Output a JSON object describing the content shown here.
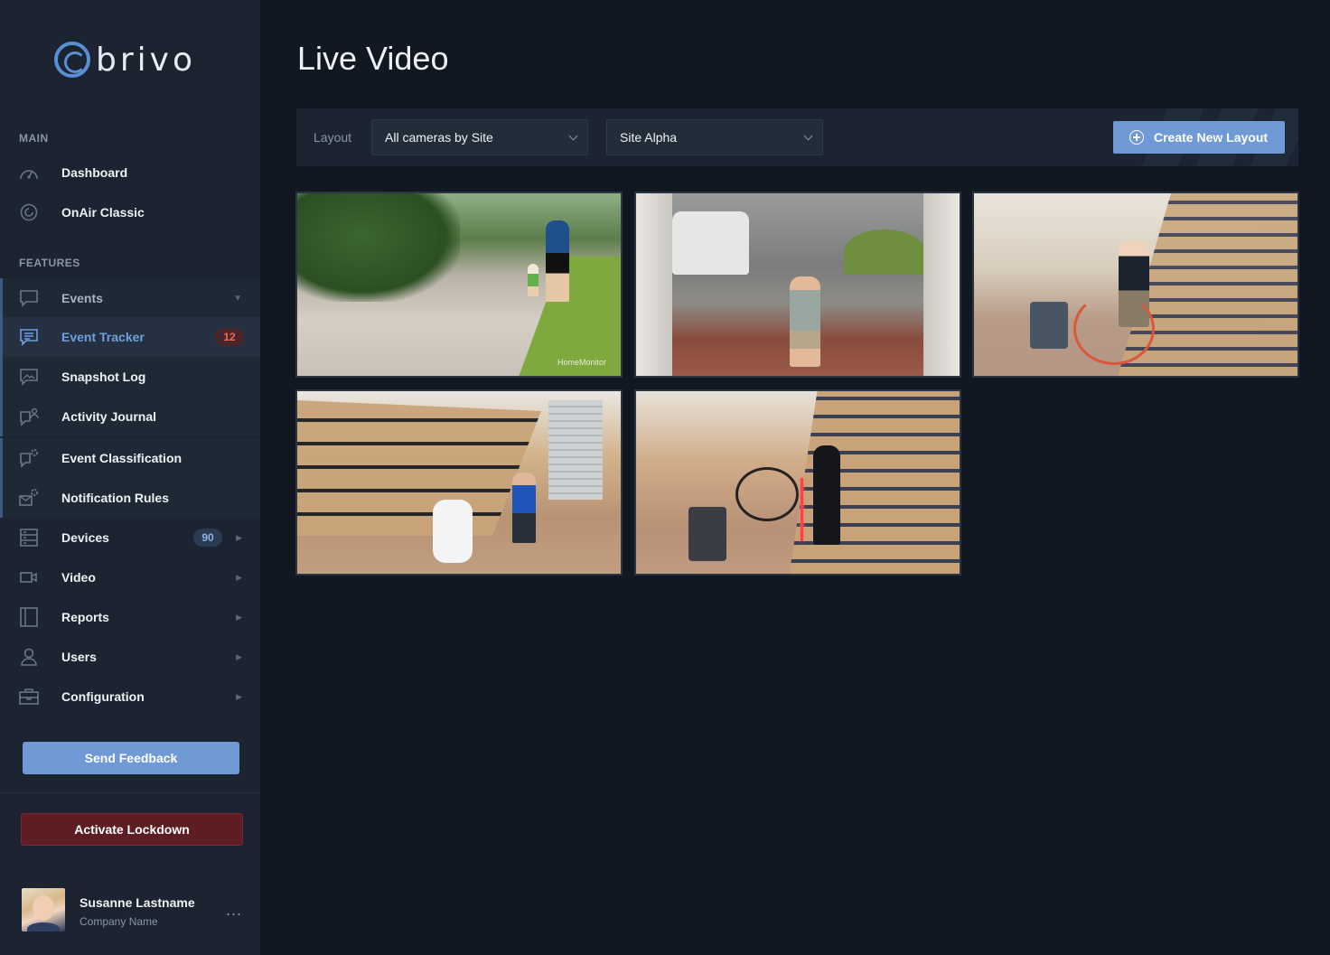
{
  "brand": {
    "name": "brivo"
  },
  "sidebar": {
    "sections": {
      "main": "MAIN",
      "features": "FEATURES"
    },
    "main_items": [
      {
        "label": "Dashboard",
        "icon": "gauge-icon"
      },
      {
        "label": "OnAir Classic",
        "icon": "onair-icon"
      }
    ],
    "feature_items": [
      {
        "label": "Events",
        "icon": "chat-icon",
        "expanded": true
      },
      {
        "label": "Event Tracker",
        "icon": "event-tracker-icon",
        "badge": "12",
        "active": true
      },
      {
        "label": "Snapshot Log",
        "icon": "image-icon"
      },
      {
        "label": "Activity Journal",
        "icon": "journal-icon"
      },
      {
        "label": "Event Classification",
        "icon": "classification-icon"
      },
      {
        "label": "Notification Rules",
        "icon": "mail-gear-icon"
      },
      {
        "label": "Devices",
        "icon": "devices-icon",
        "badge": "90"
      },
      {
        "label": "Video",
        "icon": "video-icon"
      },
      {
        "label": "Reports",
        "icon": "reports-icon"
      },
      {
        "label": "Users",
        "icon": "user-icon"
      },
      {
        "label": "Configuration",
        "icon": "toolbox-icon"
      }
    ],
    "send_feedback": "Send Feedback",
    "activate_lockdown": "Activate Lockdown",
    "user": {
      "name": "Susanne Lastname",
      "company": "Company Name",
      "more": "..."
    }
  },
  "main": {
    "title": "Live Video",
    "toolbar": {
      "layout_label": "Layout",
      "layout_value": "All cameras by Site",
      "site_value": "Site Alpha",
      "create_button": "Create New Layout"
    },
    "cameras": [
      {
        "scene": "driveway",
        "watermark": "HomeMonitor"
      },
      {
        "scene": "parking-lot entrance"
      },
      {
        "scene": "warehouse with bicycle"
      },
      {
        "scene": "warehouse shelves"
      },
      {
        "scene": "warehouse storage room"
      }
    ]
  },
  "colors": {
    "sidebar_bg": "#1b2430",
    "page_bg": "#121821",
    "accent": "#6f9ad6",
    "active_text": "#6f9fe0",
    "badge_red": "#ef6b5e",
    "lockdown": "#5d1d23"
  }
}
